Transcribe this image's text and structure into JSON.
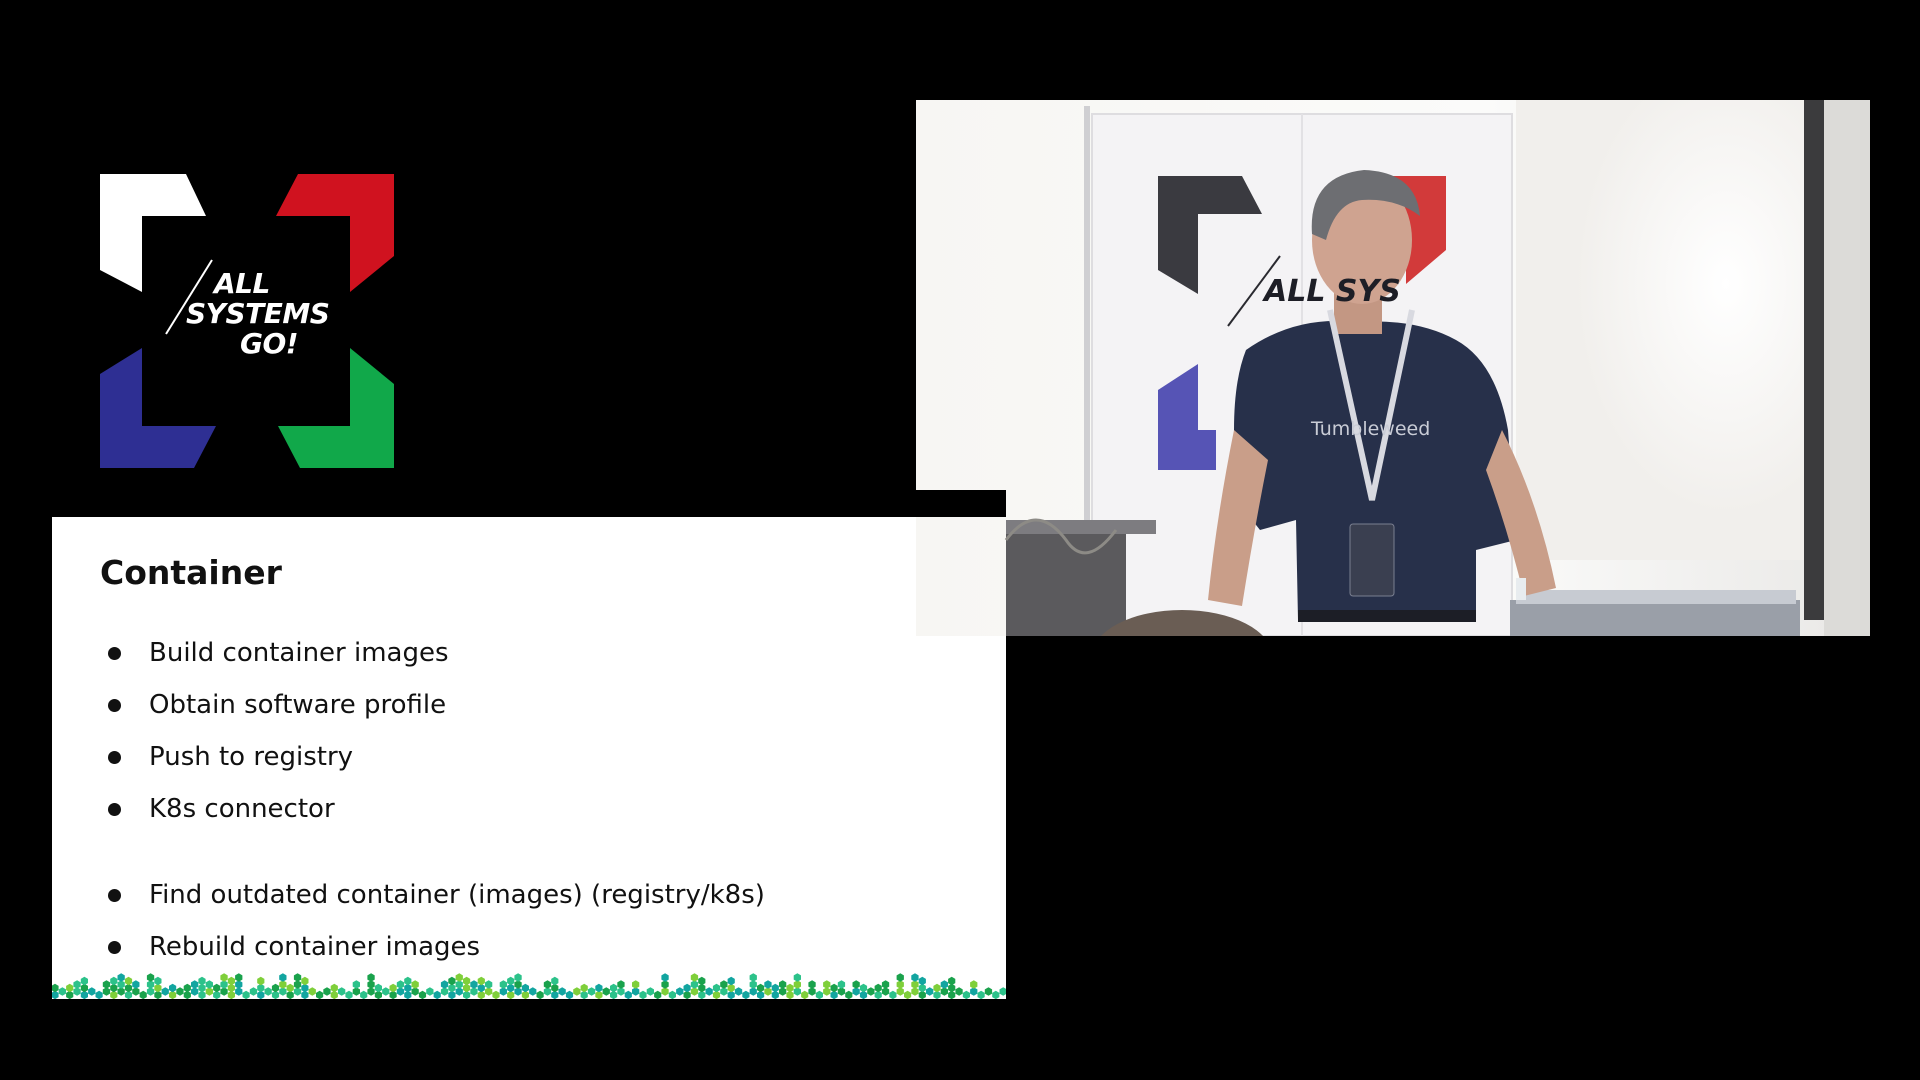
{
  "logo": {
    "line1": "ALL",
    "line2": "SYSTEMS",
    "line3": "GO!",
    "colors": {
      "top_left": "#ffffff",
      "top_right": "#d0121f",
      "bottom_left": "#2e2f93",
      "bottom_right": "#11a84a"
    }
  },
  "slide": {
    "title": "Container",
    "bullets": [
      "Build container images",
      "Obtain software profile",
      "Push to registry",
      "K8s connector",
      "Find outdated container (images) (registry/k8s)",
      "Rebuild container images"
    ],
    "accent_colors": [
      "#1aa24c",
      "#2cc28a",
      "#12a5a0",
      "#7fcf3a"
    ]
  },
  "video": {
    "banner_text": "ALL SYS",
    "shirt_text": "Tumbleweed"
  }
}
